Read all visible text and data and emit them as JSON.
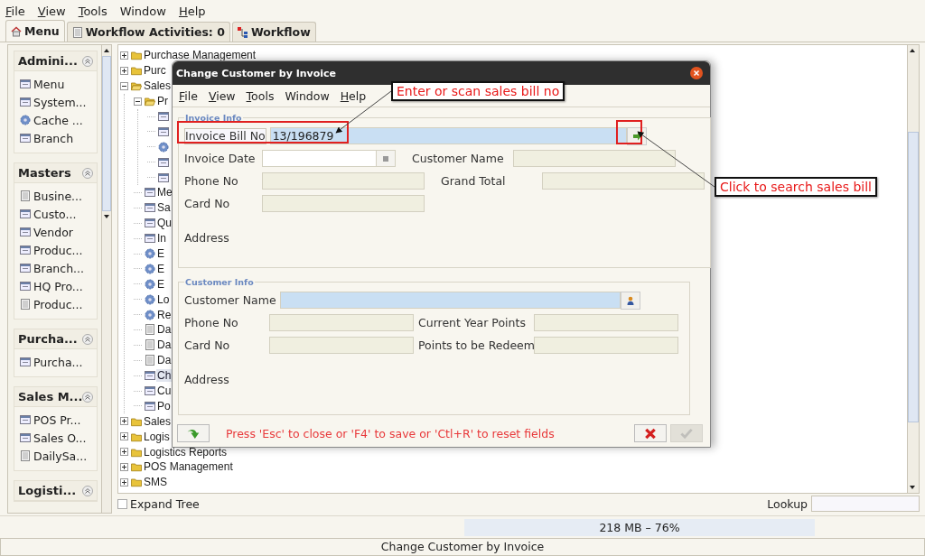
{
  "menu_bar": [
    {
      "label": "File",
      "underlined": true
    },
    {
      "label": "View",
      "underlined": true
    },
    {
      "label": "Tools",
      "underlined": true
    },
    {
      "label": "Window",
      "underlined": false
    },
    {
      "label": "Help",
      "underlined": true
    }
  ],
  "tabs": [
    {
      "label": "Menu",
      "kind": "home",
      "selected": true
    },
    {
      "label": "Workflow Activities: 0",
      "kind": "sheet",
      "selected": false
    },
    {
      "label": "Workflow",
      "kind": "flow",
      "selected": false
    }
  ],
  "sidebar": {
    "groups": [
      {
        "title": "Admini...",
        "items": [
          {
            "label": "Menu",
            "kind": "window"
          },
          {
            "label": "System...",
            "kind": "window"
          },
          {
            "label": "Cache ...",
            "kind": "gear"
          },
          {
            "label": "Branch",
            "kind": "window"
          }
        ]
      },
      {
        "title": "Masters",
        "items": [
          {
            "label": "Busine...",
            "kind": "sheet"
          },
          {
            "label": "Custo...",
            "kind": "window"
          },
          {
            "label": "Vendor",
            "kind": "window"
          },
          {
            "label": "Produc...",
            "kind": "window"
          },
          {
            "label": "Branch...",
            "kind": "window"
          },
          {
            "label": "HQ Pro...",
            "kind": "window"
          },
          {
            "label": "Produc...",
            "kind": "sheet"
          }
        ]
      },
      {
        "title": "Purcha...",
        "items": [
          {
            "label": "Purcha...",
            "kind": "window"
          }
        ]
      },
      {
        "title": "Sales M...",
        "items": [
          {
            "label": "POS Pr...",
            "kind": "window"
          },
          {
            "label": "Sales O...",
            "kind": "window"
          },
          {
            "label": "DailySa...",
            "kind": "sheet"
          }
        ]
      },
      {
        "title": "Logisti..."
      }
    ]
  },
  "tree": {
    "items": [
      {
        "label": "Purchase Management",
        "kind": "folder",
        "expanded": false,
        "selected": false
      },
      {
        "label": "Purc",
        "kind": "folder",
        "expanded": false,
        "selected": false
      },
      {
        "label": "Sales",
        "kind": "folder",
        "expanded": true,
        "selected": false,
        "children": [
          {
            "label": "Pr",
            "kind": "folder",
            "expanded": true,
            "selected": false,
            "children": [
              {
                "kind": "window",
                "selected": false
              },
              {
                "kind": "window",
                "selected": false
              },
              {
                "kind": "gear",
                "selected": false
              },
              {
                "kind": "window",
                "selected": false
              },
              {
                "kind": "window",
                "selected": false
              }
            ]
          },
          {
            "label": "Me",
            "kind": "window",
            "selected": false
          },
          {
            "label": "Sa",
            "kind": "window",
            "selected": false
          },
          {
            "label": "Qu",
            "kind": "window",
            "selected": false
          },
          {
            "label": "In",
            "kind": "window",
            "selected": false
          },
          {
            "label": "E",
            "kind": "gear",
            "selected": false
          },
          {
            "label": "E",
            "kind": "gear",
            "selected": false
          },
          {
            "label": "E",
            "kind": "gear",
            "selected": false
          },
          {
            "label": "Lo",
            "kind": "gear",
            "selected": false
          },
          {
            "label": "Re",
            "kind": "gear",
            "selected": false
          },
          {
            "label": "Da",
            "kind": "sheet",
            "selected": false
          },
          {
            "label": "Da",
            "kind": "sheet",
            "selected": false
          },
          {
            "label": "Da",
            "kind": "sheet",
            "selected": false
          },
          {
            "label": "Ch",
            "kind": "window",
            "selected": true
          },
          {
            "label": "Cu",
            "kind": "window",
            "selected": false
          },
          {
            "label": "Po",
            "kind": "window",
            "selected": false
          }
        ]
      },
      {
        "label": "Sales",
        "kind": "folder",
        "expanded": false,
        "selected": false
      },
      {
        "label": "Logis",
        "kind": "folder",
        "expanded": false,
        "selected": false
      },
      {
        "label": "Logistics Reports",
        "kind": "folder",
        "expanded": false,
        "selected": false
      },
      {
        "label": "POS Management",
        "kind": "folder",
        "expanded": false,
        "selected": false
      },
      {
        "label": "SMS",
        "kind": "folder",
        "expanded": false,
        "selected": false
      }
    ]
  },
  "expand_tree": {
    "label": "Expand Tree",
    "checked": false
  },
  "lookup": {
    "label": "Lookup"
  },
  "memory": "218 MB – 76%",
  "status_bar": "Change Customer by Invoice",
  "dialog": {
    "title": "Change Customer by Invoice",
    "menu_bar": [
      {
        "label": "File",
        "underlined": true
      },
      {
        "label": "View",
        "underlined": true
      },
      {
        "label": "Tools",
        "underlined": true
      },
      {
        "label": "Window",
        "underlined": false
      },
      {
        "label": "Help",
        "underlined": true
      }
    ],
    "sections": [
      {
        "title": "Invoice Info",
        "rows": [
          [
            {
              "label": "Invoice Bill No",
              "kind": "lookup",
              "value": "13/196879"
            }
          ],
          [
            {
              "label": "Invoice Date",
              "kind": "date"
            },
            {
              "label": "Customer Name",
              "kind": "readonly"
            }
          ],
          [
            {
              "label": "Phone No",
              "kind": "readonly"
            },
            {
              "label": "Grand Total",
              "kind": "readonly"
            }
          ],
          [
            {
              "label": "Card No",
              "kind": "readonly"
            }
          ],
          [
            {
              "label": "Address",
              "kind": "label"
            }
          ]
        ]
      },
      {
        "title": "Customer Info",
        "rows": [
          [
            {
              "label": "Customer Name",
              "kind": "person_lookup"
            }
          ],
          [
            {
              "label": "Phone No",
              "kind": "readonly"
            },
            {
              "label": "Current Year Points",
              "kind": "readonly"
            }
          ],
          [
            {
              "label": "Card No",
              "kind": "readonly"
            },
            {
              "label": "Points to be Redeem",
              "kind": "readonly"
            }
          ],
          [
            {
              "label": "Address",
              "kind": "label"
            }
          ]
        ]
      }
    ],
    "hint": "Press 'Esc' to close or 'F4' to save or 'Ctl+R' to reset fields",
    "buttons": [
      {
        "kind": "reset",
        "disabled": false
      },
      {
        "kind": "cancel",
        "disabled": false
      },
      {
        "kind": "ok",
        "disabled": true
      }
    ]
  },
  "annotations": [
    {
      "text": "Enter or scan sales bill no",
      "kind": "bill_field"
    },
    {
      "text": "Click to search sales bill",
      "kind": "search_button"
    }
  ]
}
